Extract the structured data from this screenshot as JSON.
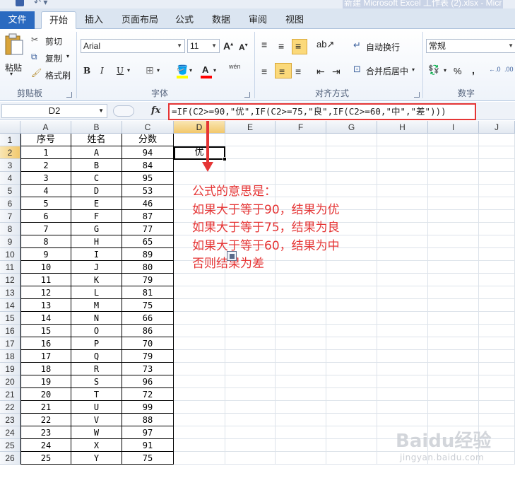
{
  "window": {
    "title": "新建 Microsoft Excel 工作表 (2).xlsx - Micr"
  },
  "tabs": {
    "items": [
      "文件",
      "开始",
      "插入",
      "页面布局",
      "公式",
      "数据",
      "审阅",
      "视图"
    ],
    "active": "开始"
  },
  "ribbon": {
    "clipboard": {
      "paste": "粘贴",
      "cut": "剪切",
      "copy": "复制",
      "format_painter": "格式刷",
      "label": "剪贴板"
    },
    "font": {
      "name": "Arial",
      "size": "11",
      "bold": "B",
      "italic": "I",
      "underline": "U",
      "label": "字体",
      "phonetic": "wén",
      "color_accent": "#ff0000",
      "fill_accent": "#ffff00"
    },
    "alignment": {
      "wrap_text": "自动换行",
      "merge_center": "合并后居中",
      "label": "对齐方式"
    },
    "number": {
      "format": "常规",
      "percent": "%",
      "comma": ",",
      "label": "数字"
    }
  },
  "formula_bar": {
    "cell_ref": "D2",
    "fx_label": "fx",
    "formula": "=IF(C2>=90,\"优\",IF(C2>=75,\"良\",IF(C2>=60,\"中\",\"差\")))"
  },
  "sheet": {
    "columns": [
      "A",
      "B",
      "C",
      "D",
      "E",
      "F",
      "G",
      "H",
      "I",
      "J"
    ],
    "rows": [
      "1",
      "2",
      "3",
      "4",
      "5",
      "6",
      "7",
      "8",
      "9",
      "10",
      "11",
      "12",
      "13",
      "14",
      "15",
      "16",
      "17",
      "18",
      "19",
      "20",
      "21",
      "22",
      "23",
      "24",
      "25",
      "26"
    ],
    "header": [
      "序号",
      "姓名",
      "分数"
    ],
    "data": [
      [
        "1",
        "A",
        "94"
      ],
      [
        "2",
        "B",
        "84"
      ],
      [
        "3",
        "C",
        "95"
      ],
      [
        "4",
        "D",
        "53"
      ],
      [
        "5",
        "E",
        "46"
      ],
      [
        "6",
        "F",
        "87"
      ],
      [
        "7",
        "G",
        "77"
      ],
      [
        "8",
        "H",
        "65"
      ],
      [
        "9",
        "I",
        "89"
      ],
      [
        "10",
        "J",
        "80"
      ],
      [
        "11",
        "K",
        "79"
      ],
      [
        "12",
        "L",
        "81"
      ],
      [
        "13",
        "M",
        "75"
      ],
      [
        "14",
        "N",
        "66"
      ],
      [
        "15",
        "O",
        "86"
      ],
      [
        "16",
        "P",
        "70"
      ],
      [
        "17",
        "Q",
        "79"
      ],
      [
        "18",
        "R",
        "73"
      ],
      [
        "19",
        "S",
        "96"
      ],
      [
        "20",
        "T",
        "72"
      ],
      [
        "21",
        "U",
        "99"
      ],
      [
        "22",
        "V",
        "88"
      ],
      [
        "23",
        "W",
        "97"
      ],
      [
        "24",
        "X",
        "91"
      ],
      [
        "25",
        "Y",
        "75"
      ]
    ],
    "d2_value": "优",
    "selected_cell": "D2"
  },
  "annotation": {
    "lines": [
      "公式的意思是：",
      "如果大于等于90，结果为优",
      "如果大于等于75，结果为良",
      "如果大于等于60，结果为中",
      "否则结果为差"
    ],
    "color": "#e53535"
  },
  "watermark": {
    "brand": "Baidu经验",
    "url": "jingyan.baidu.com"
  }
}
